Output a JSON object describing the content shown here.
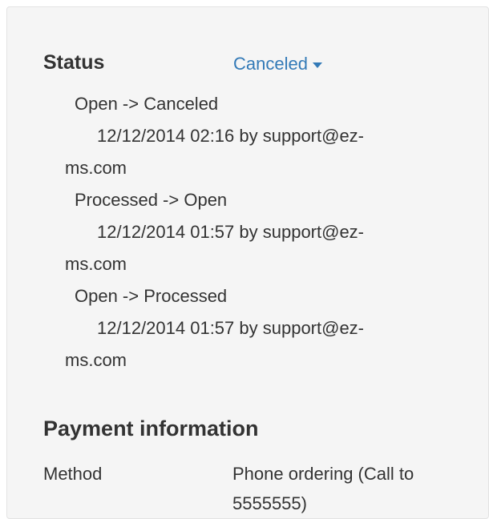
{
  "status": {
    "heading": "Status",
    "current": "Canceled",
    "history": [
      {
        "transition": "Open -> Canceled",
        "meta": "12/12/2014 02:16 by support@ez-ms.com"
      },
      {
        "transition": "Processed -> Open",
        "meta": "12/12/2014 01:57 by support@ez-ms.com"
      },
      {
        "transition": "Open -> Processed",
        "meta": "12/12/2014 01:57 by support@ez-ms.com"
      }
    ]
  },
  "payment": {
    "heading": "Payment information",
    "method_label": "Method",
    "method_value": "Phone ordering (Call to 5555555)"
  },
  "colors": {
    "link": "#337ab7",
    "text": "#333333",
    "panel_bg": "#f5f5f5"
  },
  "icons": {
    "dropdown": "caret-down-icon"
  }
}
